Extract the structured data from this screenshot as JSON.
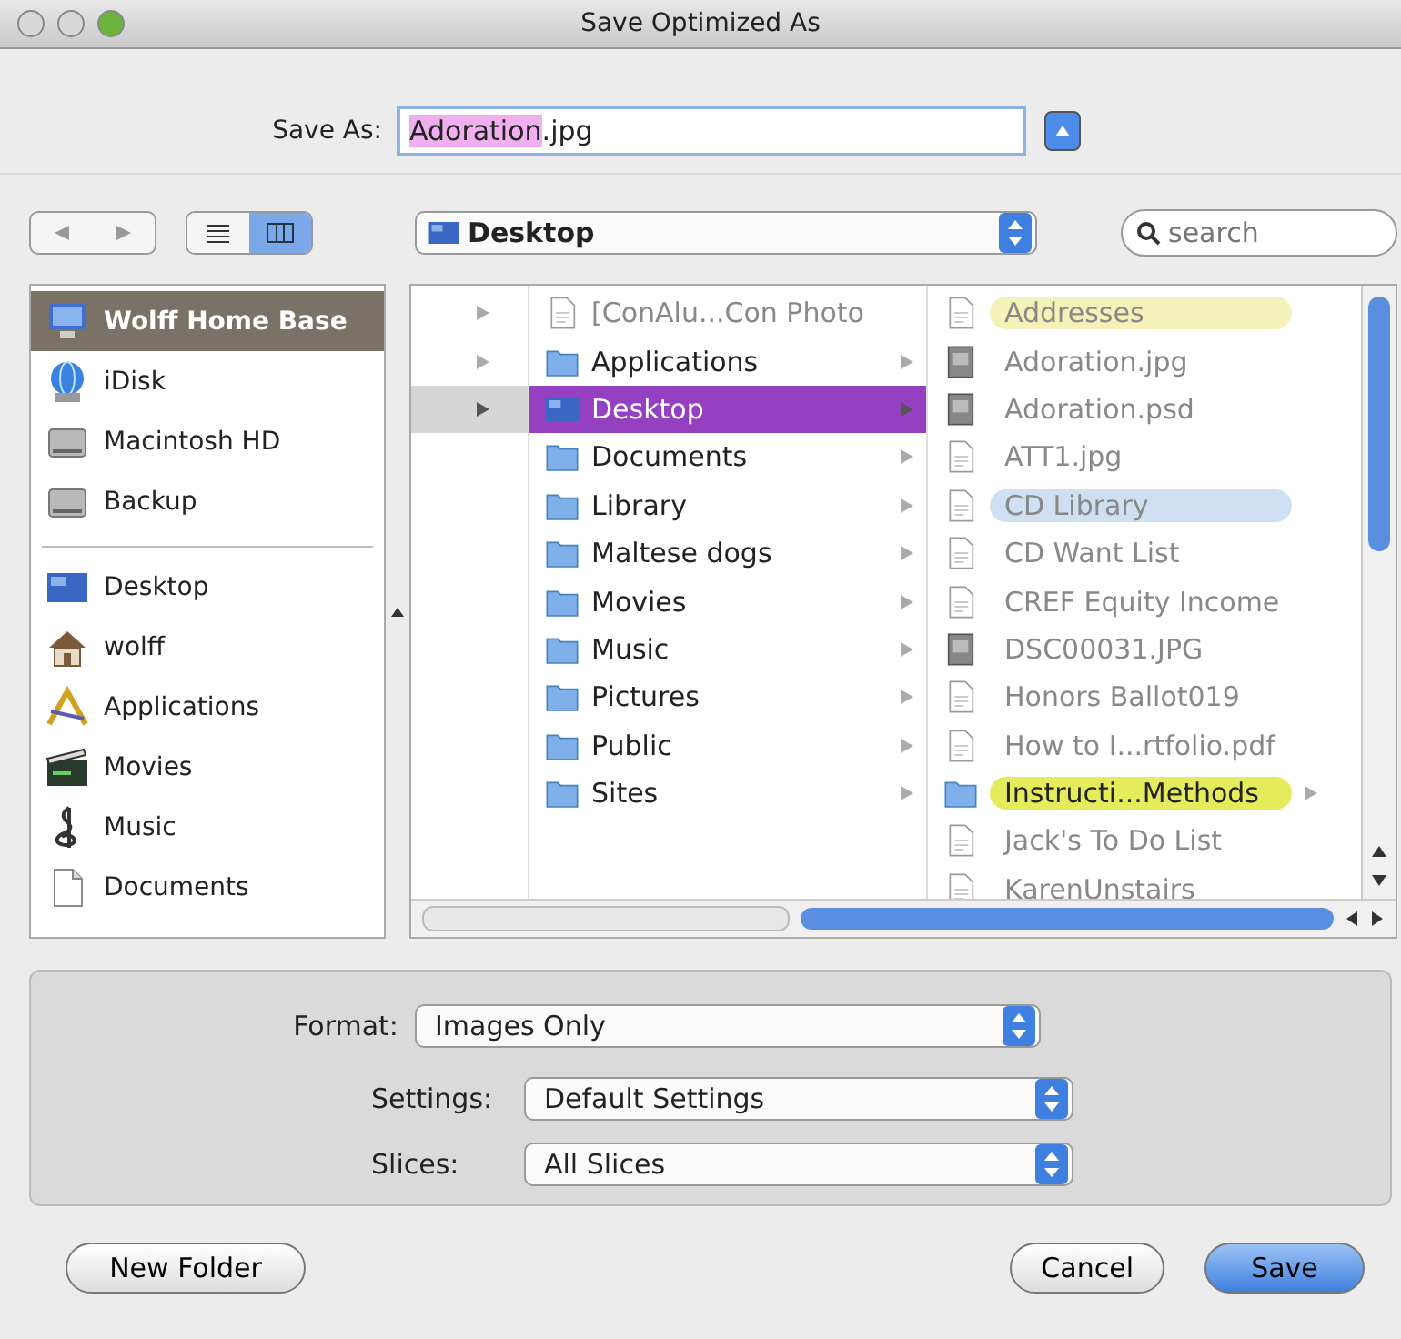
{
  "window": {
    "title": "Save Optimized As"
  },
  "save_as": {
    "label": "Save As:",
    "value": [
      {
        "text": "Adoration",
        "selected": true
      },
      {
        "text": ".jpg",
        "selected": false
      }
    ]
  },
  "toolbar": {
    "view_buttons": [
      {
        "kind": "list",
        "selected": false
      },
      {
        "kind": "columns",
        "selected": true
      }
    ],
    "location": {
      "value": "Desktop"
    },
    "search": {
      "placeholder": "search"
    }
  },
  "sidebar": {
    "devices": [
      {
        "label": "Wolff Home Base",
        "kind": "computer",
        "selected": true
      },
      {
        "label": "iDisk",
        "kind": "globe",
        "selected": false
      },
      {
        "label": "Macintosh HD",
        "kind": "disk",
        "selected": false
      },
      {
        "label": "Backup",
        "kind": "disk",
        "selected": false
      }
    ],
    "places": [
      {
        "label": "Desktop",
        "kind": "desktop",
        "selected": false
      },
      {
        "label": "wolff",
        "kind": "home",
        "selected": false
      },
      {
        "label": "Applications",
        "kind": "apps",
        "selected": false
      },
      {
        "label": "Movies",
        "kind": "movies",
        "selected": false
      },
      {
        "label": "Music",
        "kind": "music",
        "selected": false
      },
      {
        "label": "Documents",
        "kind": "document",
        "selected": false
      }
    ]
  },
  "browser": {
    "column_1": [
      {
        "selected": false
      },
      {
        "selected": false
      },
      {
        "selected": true
      }
    ],
    "column_2": [
      {
        "label": "[ConAlu...Con Photo",
        "kind": "file",
        "disabled": true,
        "selected": false
      },
      {
        "label": "Applications",
        "kind": "folder",
        "disabled": false,
        "selected": false
      },
      {
        "label": "Desktop",
        "kind": "desktop",
        "disabled": false,
        "selected": true
      },
      {
        "label": "Documents",
        "kind": "folder",
        "disabled": false,
        "selected": false
      },
      {
        "label": "Library",
        "kind": "folder",
        "disabled": false,
        "selected": false
      },
      {
        "label": "Maltese dogs",
        "kind": "folder",
        "disabled": false,
        "selected": false
      },
      {
        "label": "Movies",
        "kind": "folder",
        "disabled": false,
        "selected": false
      },
      {
        "label": "Music",
        "kind": "folder",
        "disabled": false,
        "selected": false
      },
      {
        "label": "Pictures",
        "kind": "folder",
        "disabled": false,
        "selected": false
      },
      {
        "label": "Public",
        "kind": "folder",
        "disabled": false,
        "selected": false
      },
      {
        "label": "Sites",
        "kind": "folder",
        "disabled": false,
        "selected": false
      }
    ],
    "column_3": [
      {
        "label": "Addresses",
        "kind": "file",
        "disabled": true,
        "color": "#f4f2b8"
      },
      {
        "label": "Adoration.jpg",
        "kind": "image",
        "disabled": true
      },
      {
        "label": "Adoration.psd",
        "kind": "image",
        "disabled": true
      },
      {
        "label": "ATT1.jpg",
        "kind": "file",
        "disabled": true
      },
      {
        "label": "CD Library",
        "kind": "file",
        "disabled": true,
        "color": "#cfe0f2"
      },
      {
        "label": "CD Want List",
        "kind": "file",
        "disabled": true
      },
      {
        "label": "CREF Equity Income",
        "kind": "file",
        "disabled": true
      },
      {
        "label": "DSC00031.JPG",
        "kind": "image",
        "disabled": true
      },
      {
        "label": "Honors Ballot019",
        "kind": "file",
        "disabled": true
      },
      {
        "label": "How to I...rtfolio.pdf",
        "kind": "file",
        "disabled": true
      },
      {
        "label": "Instructi...Methods",
        "kind": "folder",
        "disabled": false,
        "color": "#e4ec5c"
      },
      {
        "label": "Jack's To Do List",
        "kind": "file",
        "disabled": true
      },
      {
        "label": "KarenUnstairs",
        "kind": "file",
        "disabled": true
      }
    ]
  },
  "options": {
    "format": {
      "label": "Format:",
      "value": "Images Only"
    },
    "settings": {
      "label": "Settings:",
      "value": "Default Settings"
    },
    "slices": {
      "label": "Slices:",
      "value": "All Slices"
    }
  },
  "buttons": [
    {
      "label": "New Folder",
      "kind": "normal"
    },
    {
      "label": "Cancel",
      "kind": "normal"
    },
    {
      "label": "Save",
      "kind": "default"
    }
  ]
}
